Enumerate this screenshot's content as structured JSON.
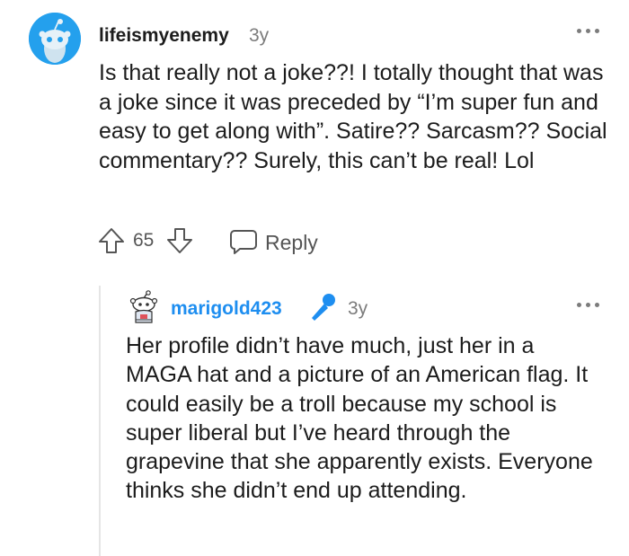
{
  "main_comment": {
    "username": "lifeismyenemy",
    "age": "3y",
    "body": "Is that really not a joke??! I totally thought that was a joke since it was preceded by “I’m super fun and easy to get along with”. Satire?? Sarcasm?? Social commentary?? Surely, this can’t be real! Lol",
    "score": "65",
    "reply_label": "Reply",
    "avatar_color": "#24a0ed",
    "icons": {
      "avatar": "snoo-avatar-icon",
      "more": "more-options-icon",
      "upvote": "upvote-arrow-icon",
      "downvote": "downvote-arrow-icon",
      "reply": "reply-bubble-icon"
    }
  },
  "reply_comment": {
    "username": "marigold423",
    "age": "3y",
    "body": "Her profile didn’t have much, just her in a MAGA hat and a picture of an American flag. It could easily be a troll because my school is super liberal but I’ve heard through the grapevine that she apparently exists. Everyone thinks she didn’t end up attending.",
    "username_color": "#1e8ef0",
    "icons": {
      "avatar": "snoo-avatar-icon",
      "flair": "microphone-icon",
      "more": "more-options-icon"
    }
  },
  "colors": {
    "text": "#1c1c1c",
    "meta": "#7c7c7c",
    "thread_line": "#e5e5e5"
  }
}
